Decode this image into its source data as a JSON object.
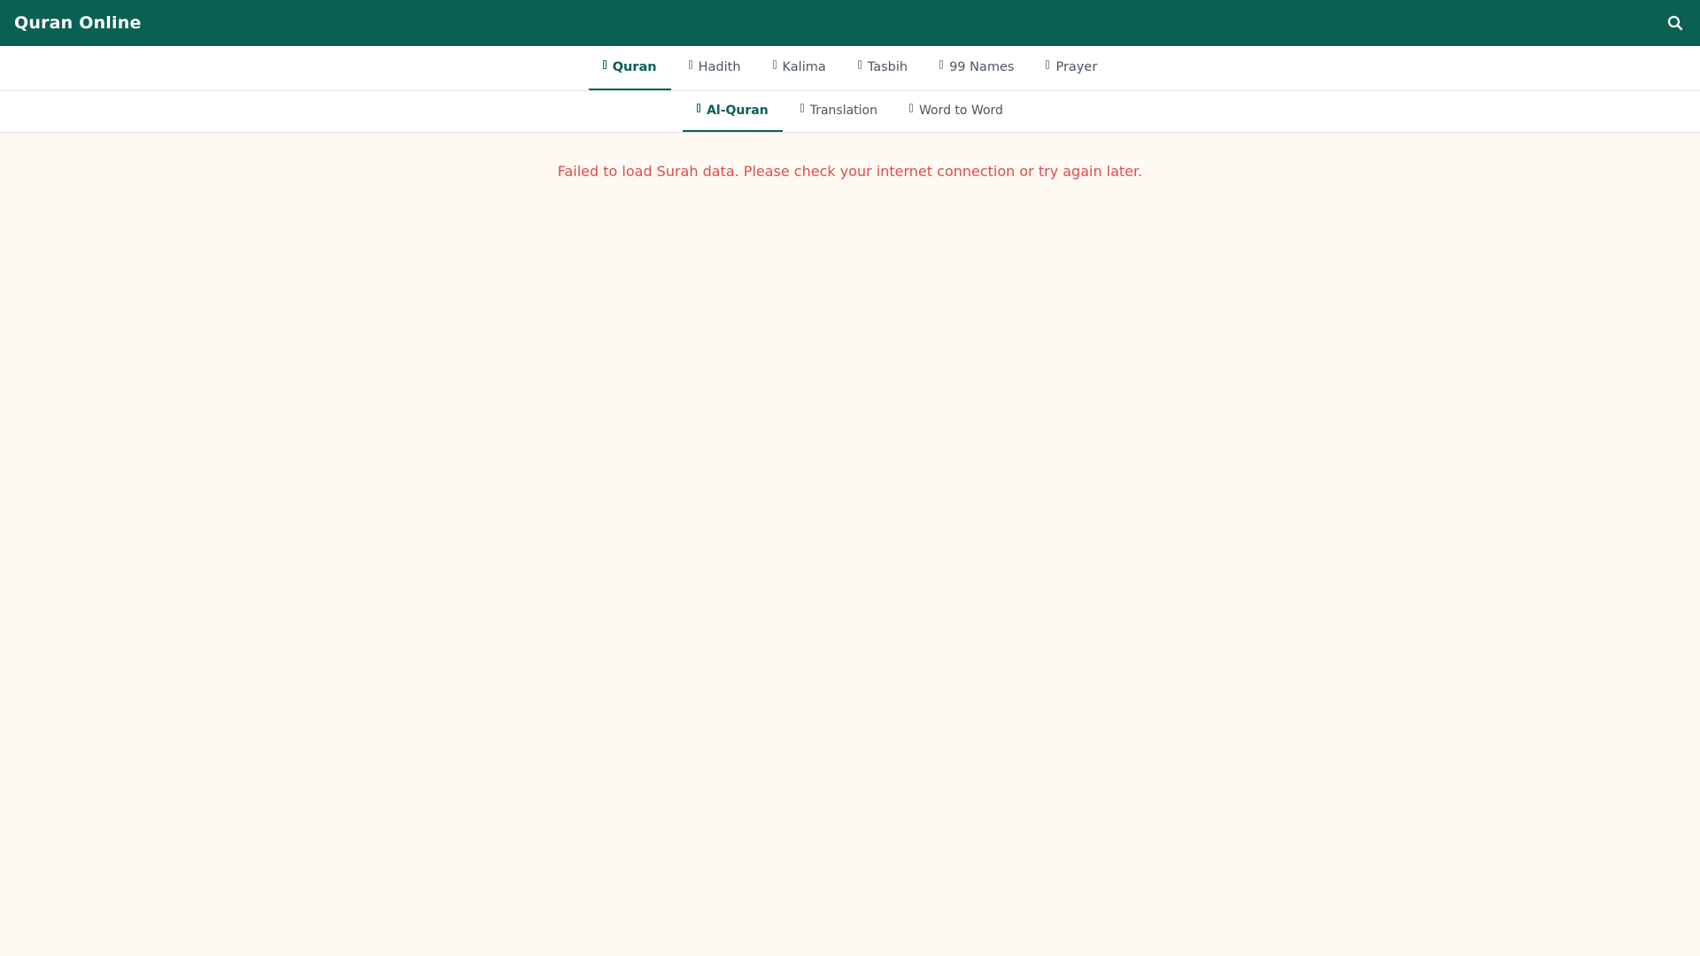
{
  "header": {
    "title": "Quran Online",
    "icon": "search-icon"
  },
  "main_nav": {
    "tabs": [
      {
        "label": "Quran",
        "active": true
      },
      {
        "label": "Hadith",
        "active": false
      },
      {
        "label": "Kalima",
        "active": false
      },
      {
        "label": "Tasbih",
        "active": false
      },
      {
        "label": "99 Names",
        "active": false
      },
      {
        "label": "Prayer",
        "active": false
      }
    ]
  },
  "sub_nav": {
    "tabs": [
      {
        "label": "Al-Quran",
        "active": true
      },
      {
        "label": "Translation",
        "active": false
      },
      {
        "label": "Word to Word",
        "active": false
      }
    ]
  },
  "content": {
    "error": "Failed to load Surah data. Please check your internet connection or try again later."
  },
  "colors": {
    "brand": "#0b6054",
    "error": "#e14b4b",
    "background": "#fefaf3"
  }
}
